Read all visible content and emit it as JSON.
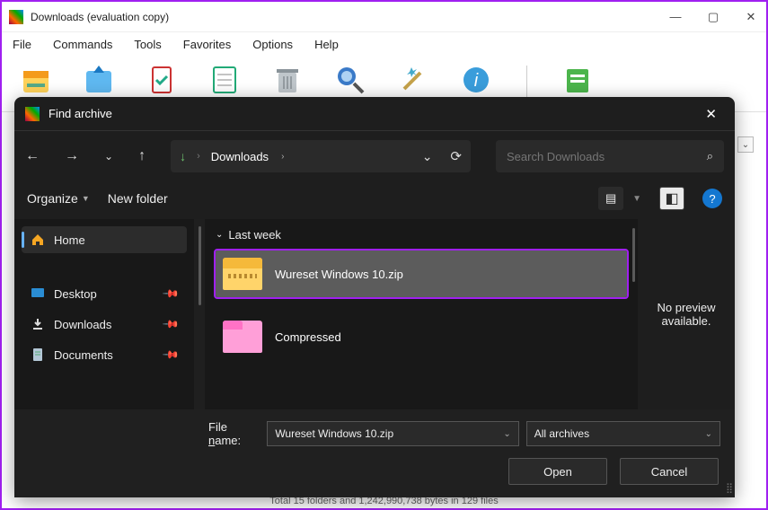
{
  "winrar": {
    "title": "Downloads (evaluation copy)",
    "menu": [
      "File",
      "Commands",
      "Tools",
      "Favorites",
      "Options",
      "Help"
    ],
    "status": "Total 15 folders and 1,242,990,738 bytes in 129 files"
  },
  "dialog": {
    "title": "Find archive",
    "breadcrumb": {
      "location": "Downloads"
    },
    "search": {
      "placeholder": "Search Downloads"
    },
    "tools": {
      "organize": "Organize",
      "newfolder": "New folder"
    },
    "sidebar": {
      "home": "Home",
      "items": [
        {
          "label": "Desktop"
        },
        {
          "label": "Downloads"
        },
        {
          "label": "Documents"
        }
      ]
    },
    "group_header": "Last week",
    "files": [
      {
        "name": "Wureset Windows 10.zip",
        "kind": "zip",
        "selected": true
      },
      {
        "name": "Compressed",
        "kind": "folder",
        "selected": false
      }
    ],
    "preview_text": "No preview available.",
    "filename_label": "File name:",
    "filename_value": "Wureset Windows 10.zip",
    "filter_value": "All archives",
    "open_label": "Open",
    "cancel_label": "Cancel"
  }
}
